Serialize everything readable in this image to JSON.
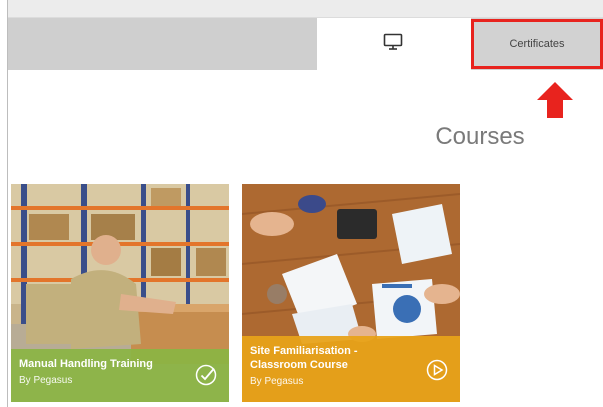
{
  "tabs": {
    "monitor_icon": "monitor-icon",
    "certificates_label": "Certificates"
  },
  "annotation": {
    "highlight_color": "#e8231e",
    "arrow_icon": "arrow-up-icon"
  },
  "main": {
    "title": "Courses"
  },
  "courses": [
    {
      "title": "Manual Handling Training",
      "author": "By Pegasus",
      "accent": "#8bb544",
      "status_icon": "check-circle-icon"
    },
    {
      "title": "Site Familiarisation - Classroom Course",
      "author": "By Pegasus",
      "accent": "#e8a318",
      "status_icon": "play-circle-icon"
    }
  ]
}
